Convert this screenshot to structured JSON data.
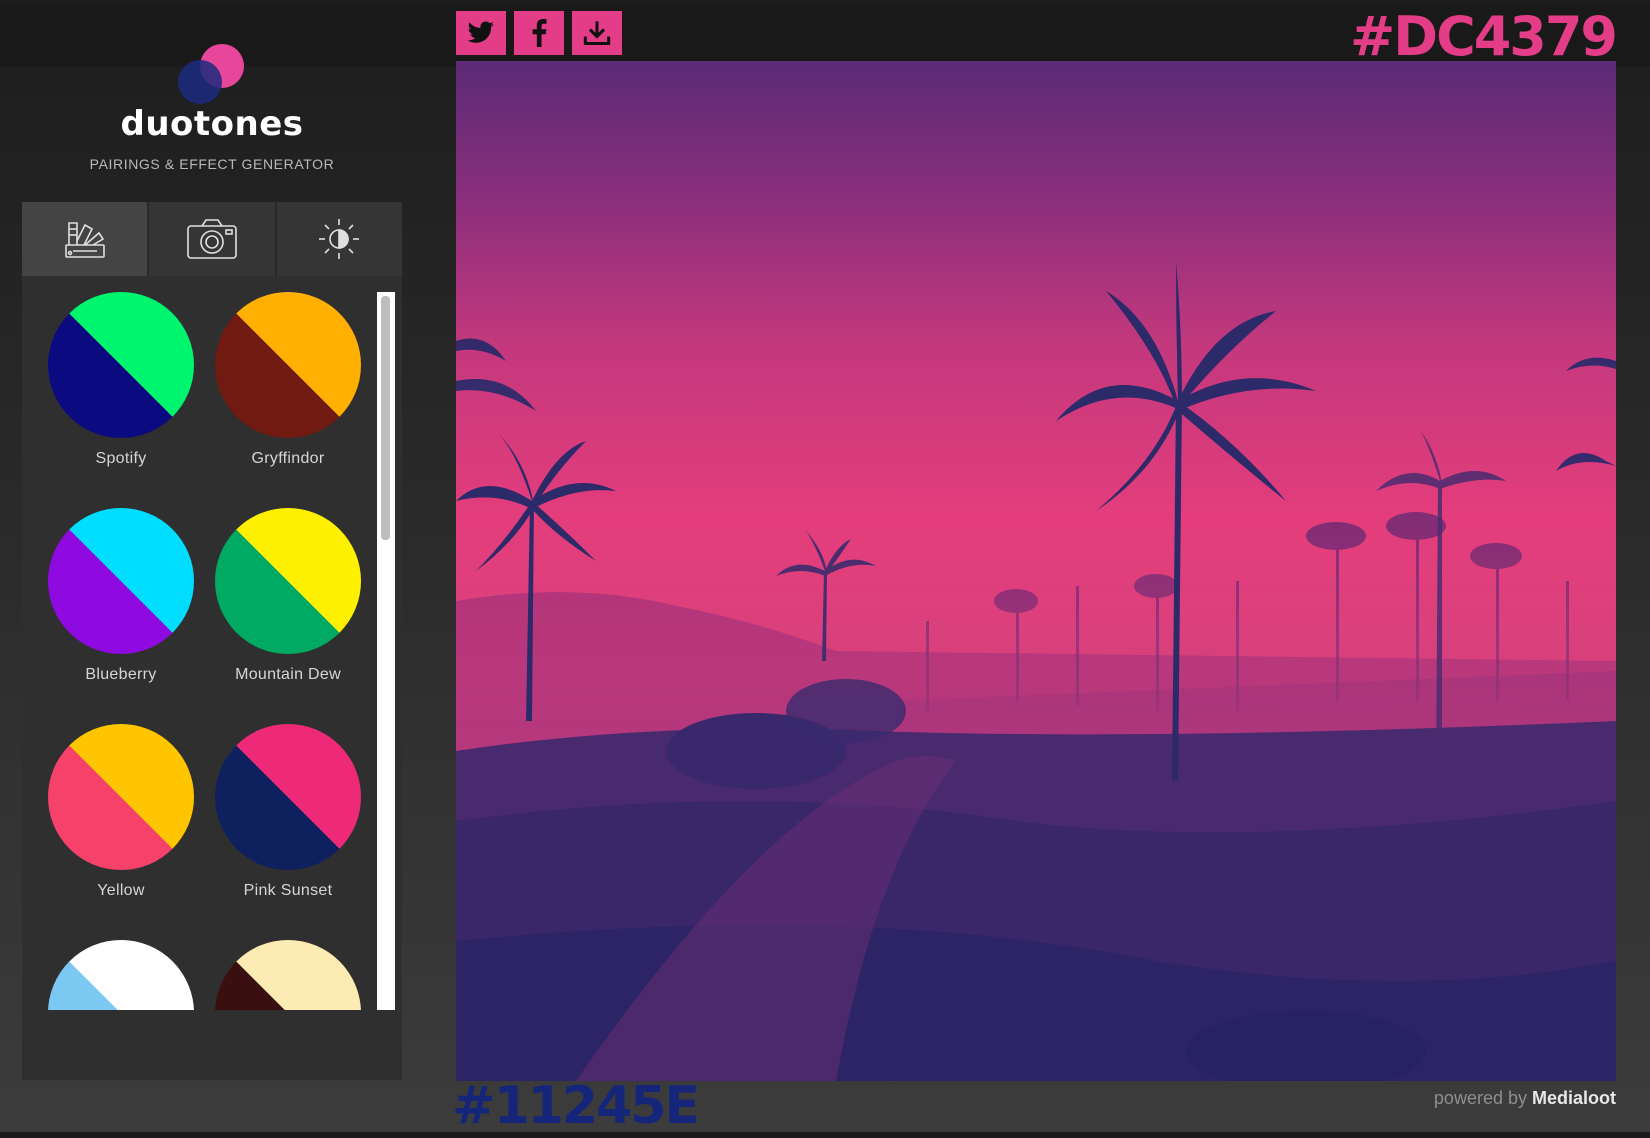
{
  "brand": {
    "name": "duotones",
    "tagline": "PAIRINGS & EFFECT GENERATOR"
  },
  "tabs": [
    {
      "icon": "palette-swatch-icon",
      "active": true
    },
    {
      "icon": "camera-icon",
      "active": false
    },
    {
      "icon": "brightness-icon",
      "active": false
    }
  ],
  "swatches": [
    {
      "name": "Spotify",
      "light": "#00F56E",
      "dark": "#0B0A80"
    },
    {
      "name": "Gryffindor",
      "light": "#FFB000",
      "dark": "#701A12"
    },
    {
      "name": "Blueberry",
      "light": "#00DDFE",
      "dark": "#8E0AE0"
    },
    {
      "name": "Mountain Dew",
      "light": "#FFF000",
      "dark": "#00AA62"
    },
    {
      "name": "Yellow",
      "light": "#FFC600",
      "dark": "#F6426A"
    },
    {
      "name": "Pink Sunset",
      "light": "#EE2A78",
      "dark": "#0E205E"
    },
    {
      "name": "",
      "light": "#FFFFFF",
      "dark": "#7BC9F2"
    },
    {
      "name": "",
      "light": "#FCEBB2",
      "dark": "#3A0F0F"
    }
  ],
  "share": [
    {
      "icon": "twitter-icon"
    },
    {
      "icon": "facebook-icon"
    },
    {
      "icon": "download-icon"
    }
  ],
  "colors": {
    "highlight": "#DC4379",
    "shadow": "#11245E"
  },
  "footer": {
    "powered_prefix": "powered by",
    "powered_brand": "Medialoot"
  }
}
